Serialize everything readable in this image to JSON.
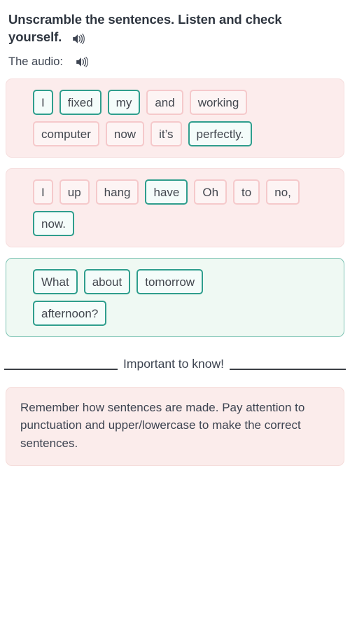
{
  "header": {
    "title": "Unscramble the sentences. Listen and check yourself.",
    "title_line1": "Unscramble the sentences. Listen and check",
    "title_line2": "yourself.",
    "title_audio_icon": "speaker-icon",
    "audio_label": "The audio:",
    "audio_icon": "speaker-icon"
  },
  "blocks": [
    {
      "id": "block-1",
      "state": "pink",
      "rows": [
        [
          {
            "text": "I",
            "state": "green"
          },
          {
            "text": "fixed",
            "state": "green"
          },
          {
            "text": "my",
            "state": "green"
          },
          {
            "text": "and",
            "state": "pink"
          },
          {
            "text": "working",
            "state": "pink"
          }
        ],
        [
          {
            "text": "computer",
            "state": "pink"
          },
          {
            "text": "now",
            "state": "pink"
          },
          {
            "text": "it’s",
            "state": "pink"
          },
          {
            "text": "perfectly.",
            "state": "green"
          }
        ]
      ]
    },
    {
      "id": "block-2",
      "state": "pink",
      "rows": [
        [
          {
            "text": "I",
            "state": "pink"
          },
          {
            "text": "up",
            "state": "pink"
          },
          {
            "text": "hang",
            "state": "pink"
          },
          {
            "text": "have",
            "state": "green"
          },
          {
            "text": "Oh",
            "state": "pink"
          },
          {
            "text": "to",
            "state": "pink"
          },
          {
            "text": "no,",
            "state": "pink"
          }
        ],
        [
          {
            "text": "now.",
            "state": "green"
          }
        ]
      ]
    },
    {
      "id": "block-3",
      "state": "green",
      "rows": [
        [
          {
            "text": "What",
            "state": "green"
          },
          {
            "text": "about",
            "state": "green"
          },
          {
            "text": "tomorrow",
            "state": "green"
          }
        ],
        [
          {
            "text": "afternoon?",
            "state": "green"
          }
        ]
      ]
    }
  ],
  "divider": {
    "text": "Important to know!"
  },
  "tip": {
    "text": "Remember how sentences are made. Pay attention to punctuation and upper/lowercase to make the correct sentences."
  },
  "colors": {
    "correct_border": "#2f9e8d",
    "correct_fill": "#f4fcfa",
    "wrong_border": "#f5c9cb",
    "wrong_fill": "#fdf4f4",
    "pink_panel": "#fcecec",
    "green_panel": "#eff9f3",
    "text": "#3d4451"
  }
}
